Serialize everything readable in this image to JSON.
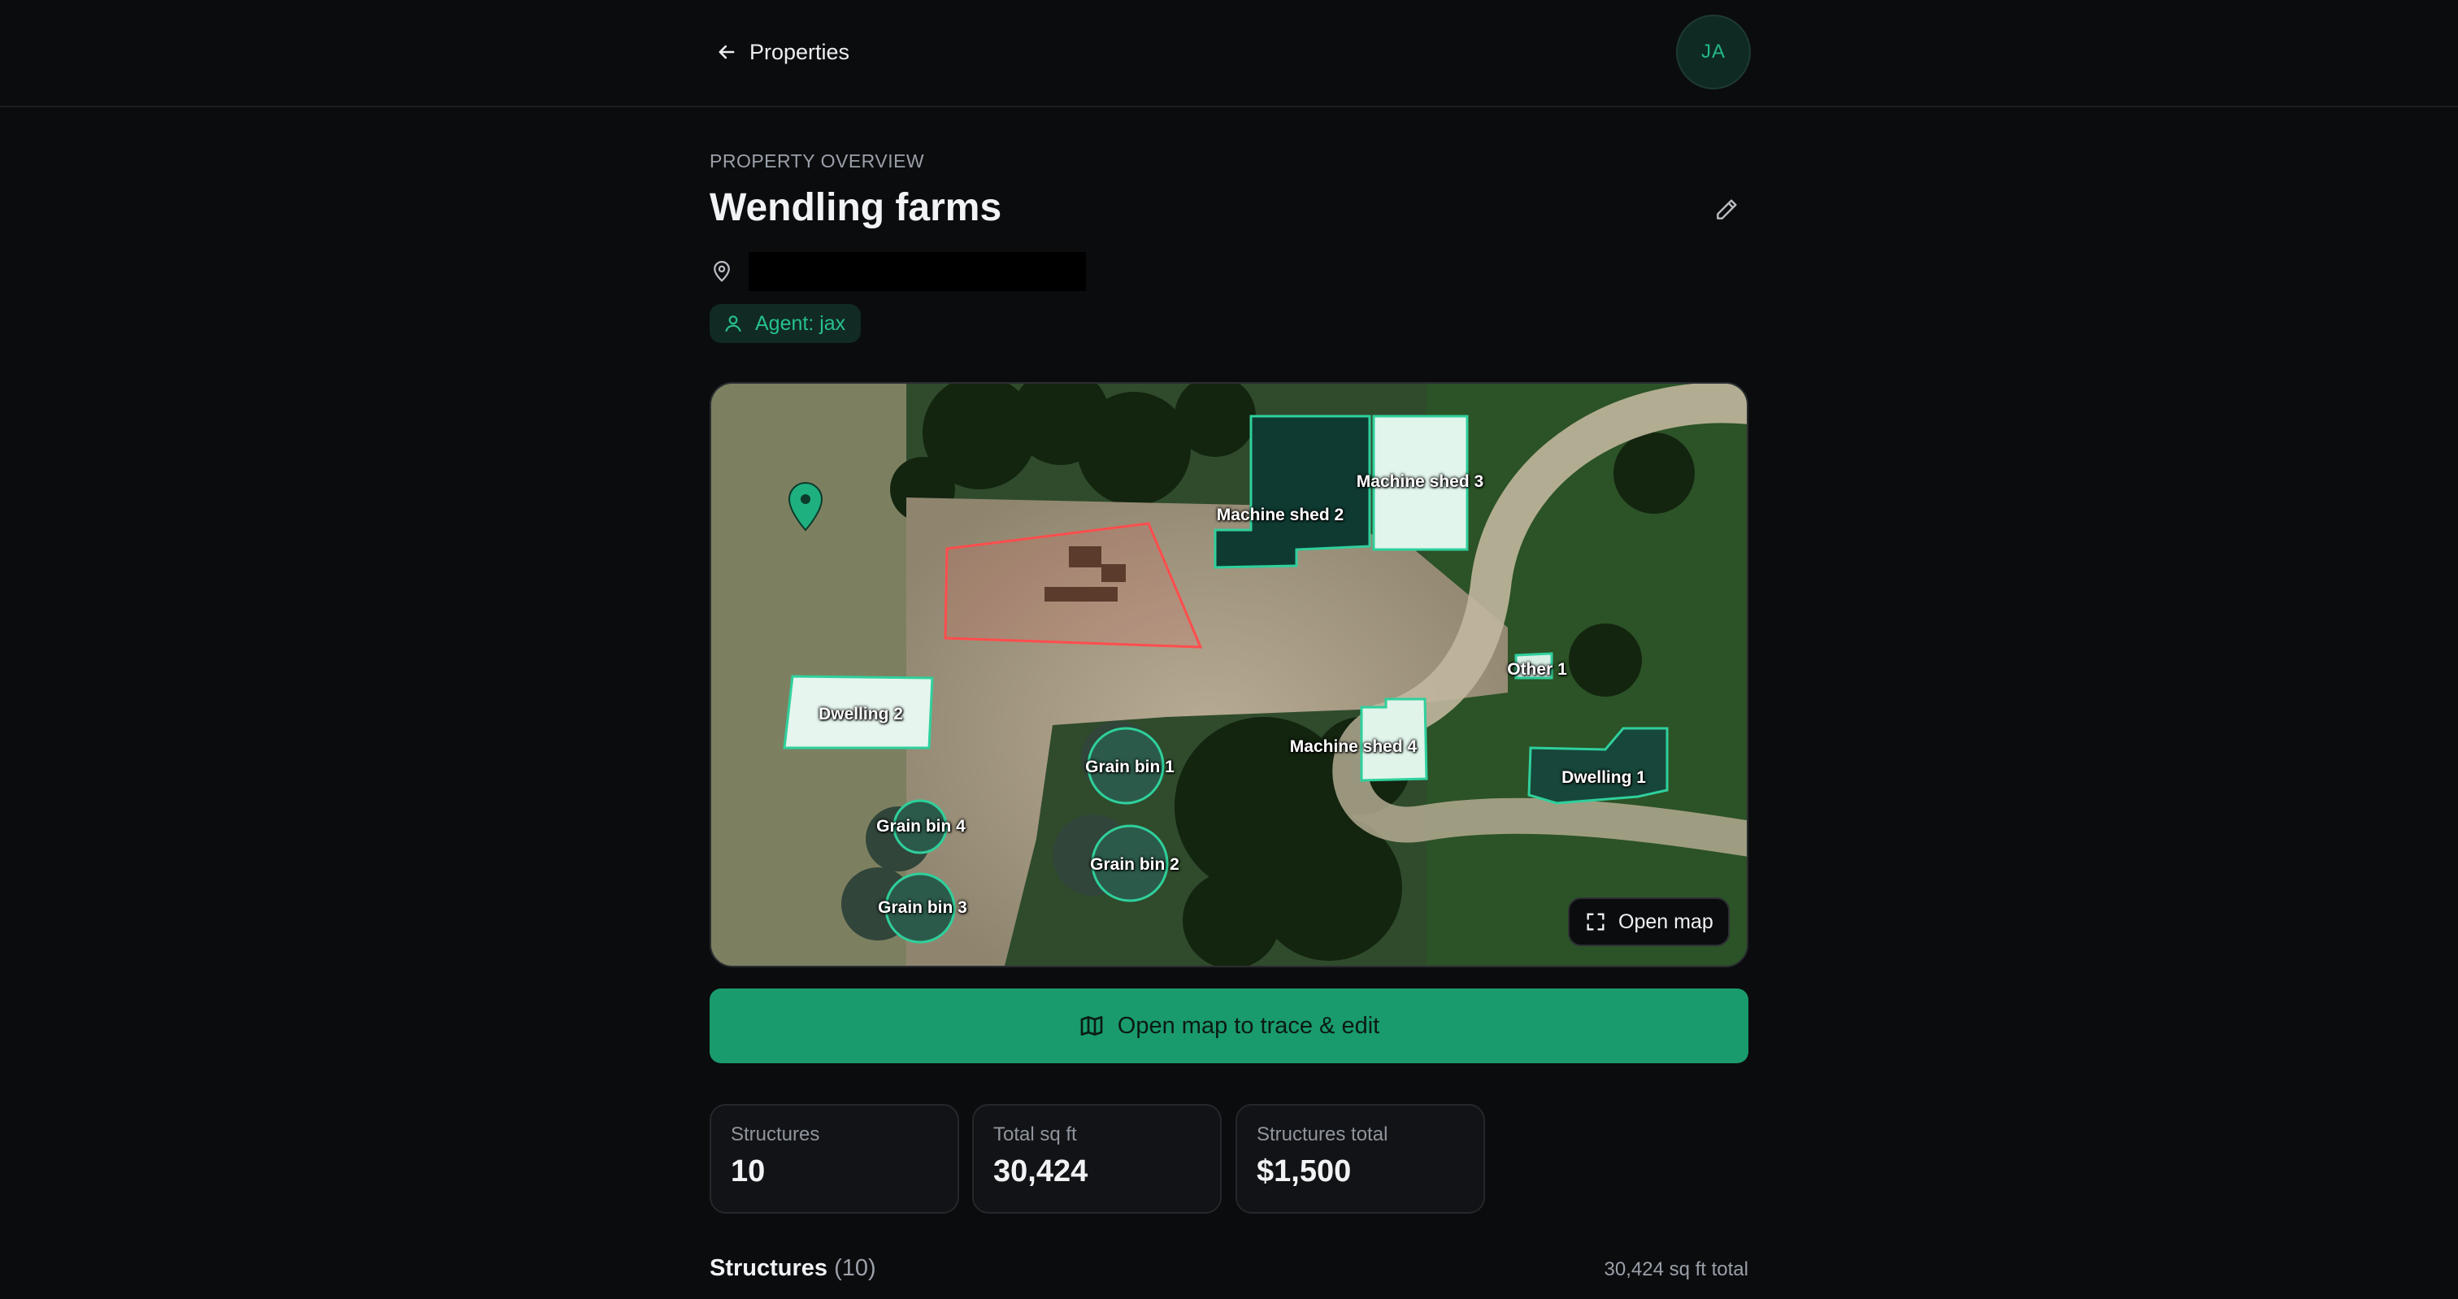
{
  "header": {
    "back_label": "Properties",
    "avatar_initials": "JA"
  },
  "property": {
    "eyebrow": "PROPERTY OVERVIEW",
    "name": "Wendling farms",
    "agent": "Agent: jax"
  },
  "map": {
    "labels": {
      "machine_shed_2": "Machine shed 2",
      "machine_shed_3": "Machine shed 3",
      "machine_shed_4": "Machine shed 4",
      "other_1": "Other 1",
      "dwelling_1": "Dwelling 1",
      "dwelling_2": "Dwelling 2",
      "grain_bin_1": "Grain bin 1",
      "grain_bin_2": "Grain bin 2",
      "grain_bin_3": "Grain bin 3",
      "grain_bin_4": "Grain bin 4"
    },
    "open_map_label": "Open map",
    "colors": {
      "structure_outline": "#2fd09c",
      "selection_outline": "#ff4d4d",
      "pin": "#1fb07f"
    }
  },
  "cta": {
    "label": "Open map to trace & edit"
  },
  "stats": [
    {
      "label": "Structures",
      "value": "10"
    },
    {
      "label": "Total sq ft",
      "value": "30,424"
    },
    {
      "label": "Structures total",
      "value": "$1,500"
    }
  ],
  "structures_section": {
    "title": "Structures",
    "count": "(10)",
    "total": "30,424 sq ft total"
  },
  "colors": {
    "accent": "#1a9b6e",
    "background": "#0b0c0e"
  }
}
